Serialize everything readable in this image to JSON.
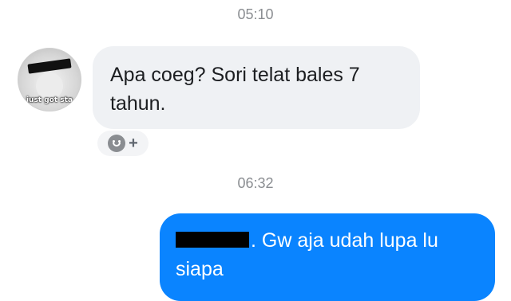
{
  "thread": {
    "timestamp_1": "05:10",
    "timestamp_2": "06:32"
  },
  "incoming": {
    "avatar_caption": "just got sta",
    "message": "Apa coeg? Sori telat bales 7 tahun."
  },
  "reaction": {
    "icon": "smile-icon",
    "plus": "+"
  },
  "outgoing": {
    "message": ". Gw aja udah lupa lu siapa"
  },
  "colors": {
    "outgoing_bubble": "#0a84ff",
    "incoming_bubble": "#eff1f4",
    "timestamp": "#8a8d91"
  }
}
